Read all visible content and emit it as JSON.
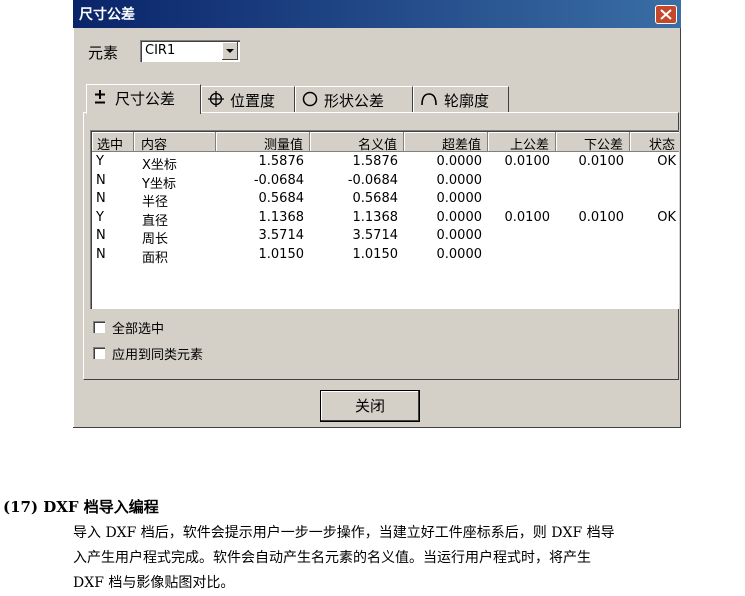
{
  "dialog": {
    "title": "尺寸公差",
    "element_label": "元素",
    "element_value": "CIR1",
    "tabs": [
      {
        "label": "尺寸公差",
        "icon": "plus-minus-icon",
        "active": true
      },
      {
        "label": "位置度",
        "icon": "position-crosshair-icon",
        "active": false
      },
      {
        "label": "形状公差",
        "icon": "circle-icon",
        "active": false
      },
      {
        "label": "轮廓度",
        "icon": "arc-icon",
        "active": false
      }
    ],
    "table": {
      "columns": [
        "选中",
        "内容",
        "测量值",
        "名义值",
        "超差值",
        "上公差",
        "下公差",
        "状态"
      ],
      "rows": [
        [
          "Y",
          "X坐标",
          "1.5876",
          "1.5876",
          "0.0000",
          "0.0100",
          "0.0100",
          "OK"
        ],
        [
          "N",
          "Y坐标",
          "-0.0684",
          "-0.0684",
          "0.0000",
          "",
          "",
          ""
        ],
        [
          "N",
          "半径",
          "0.5684",
          "0.5684",
          "0.0000",
          "",
          "",
          ""
        ],
        [
          "Y",
          "直径",
          "1.1368",
          "1.1368",
          "0.0000",
          "0.0100",
          "0.0100",
          "OK"
        ],
        [
          "N",
          "周长",
          "3.5714",
          "3.5714",
          "0.0000",
          "",
          "",
          ""
        ],
        [
          "N",
          "面积",
          "1.0150",
          "1.0150",
          "0.0000",
          "",
          "",
          ""
        ]
      ]
    },
    "checkboxes": [
      {
        "label": "全部选中",
        "checked": false
      },
      {
        "label": "应用到同类元素",
        "checked": false
      }
    ],
    "close_button": "关闭"
  },
  "document": {
    "heading": "(17) DXF 档导入编程",
    "paragraph_lines": [
      "导入 DXF 档后，软件会提示用户一步一步操作，当建立好工件座标系后，则 DXF 档导",
      "入产生用户程式完成。软件会自动产生名元素的名义值。当运行用户程式时，将产生",
      "DXF 档与影像贴图对比。"
    ]
  },
  "colors": {
    "titlebar": "#0a246a",
    "dialog_bg": "#d4d0c8",
    "close_red": "#c4492a"
  }
}
